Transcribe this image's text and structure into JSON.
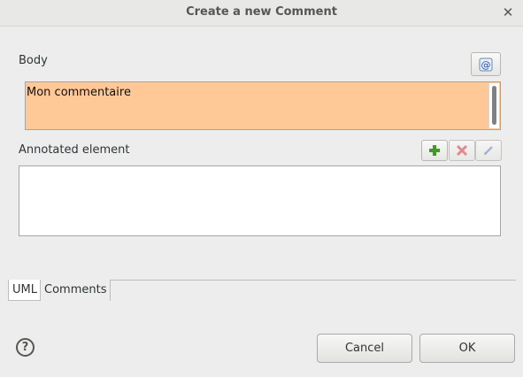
{
  "window": {
    "title": "Create a new Comment"
  },
  "body_section": {
    "label": "Body",
    "value": "Mon commentaire",
    "field_color": "#ffc896"
  },
  "annotated_section": {
    "label": "Annotated element",
    "items": []
  },
  "tabs": [
    {
      "label": "UML",
      "active": true
    },
    {
      "label": "Comments",
      "active": false
    }
  ],
  "footer": {
    "help_icon": "?",
    "cancel_label": "Cancel",
    "ok_label": "OK"
  },
  "icons": {
    "close": "close-icon",
    "at": "at-sign-icon",
    "add": "plus-icon",
    "remove": "delete-icon",
    "edit": "pencil-icon",
    "help": "help-icon"
  }
}
